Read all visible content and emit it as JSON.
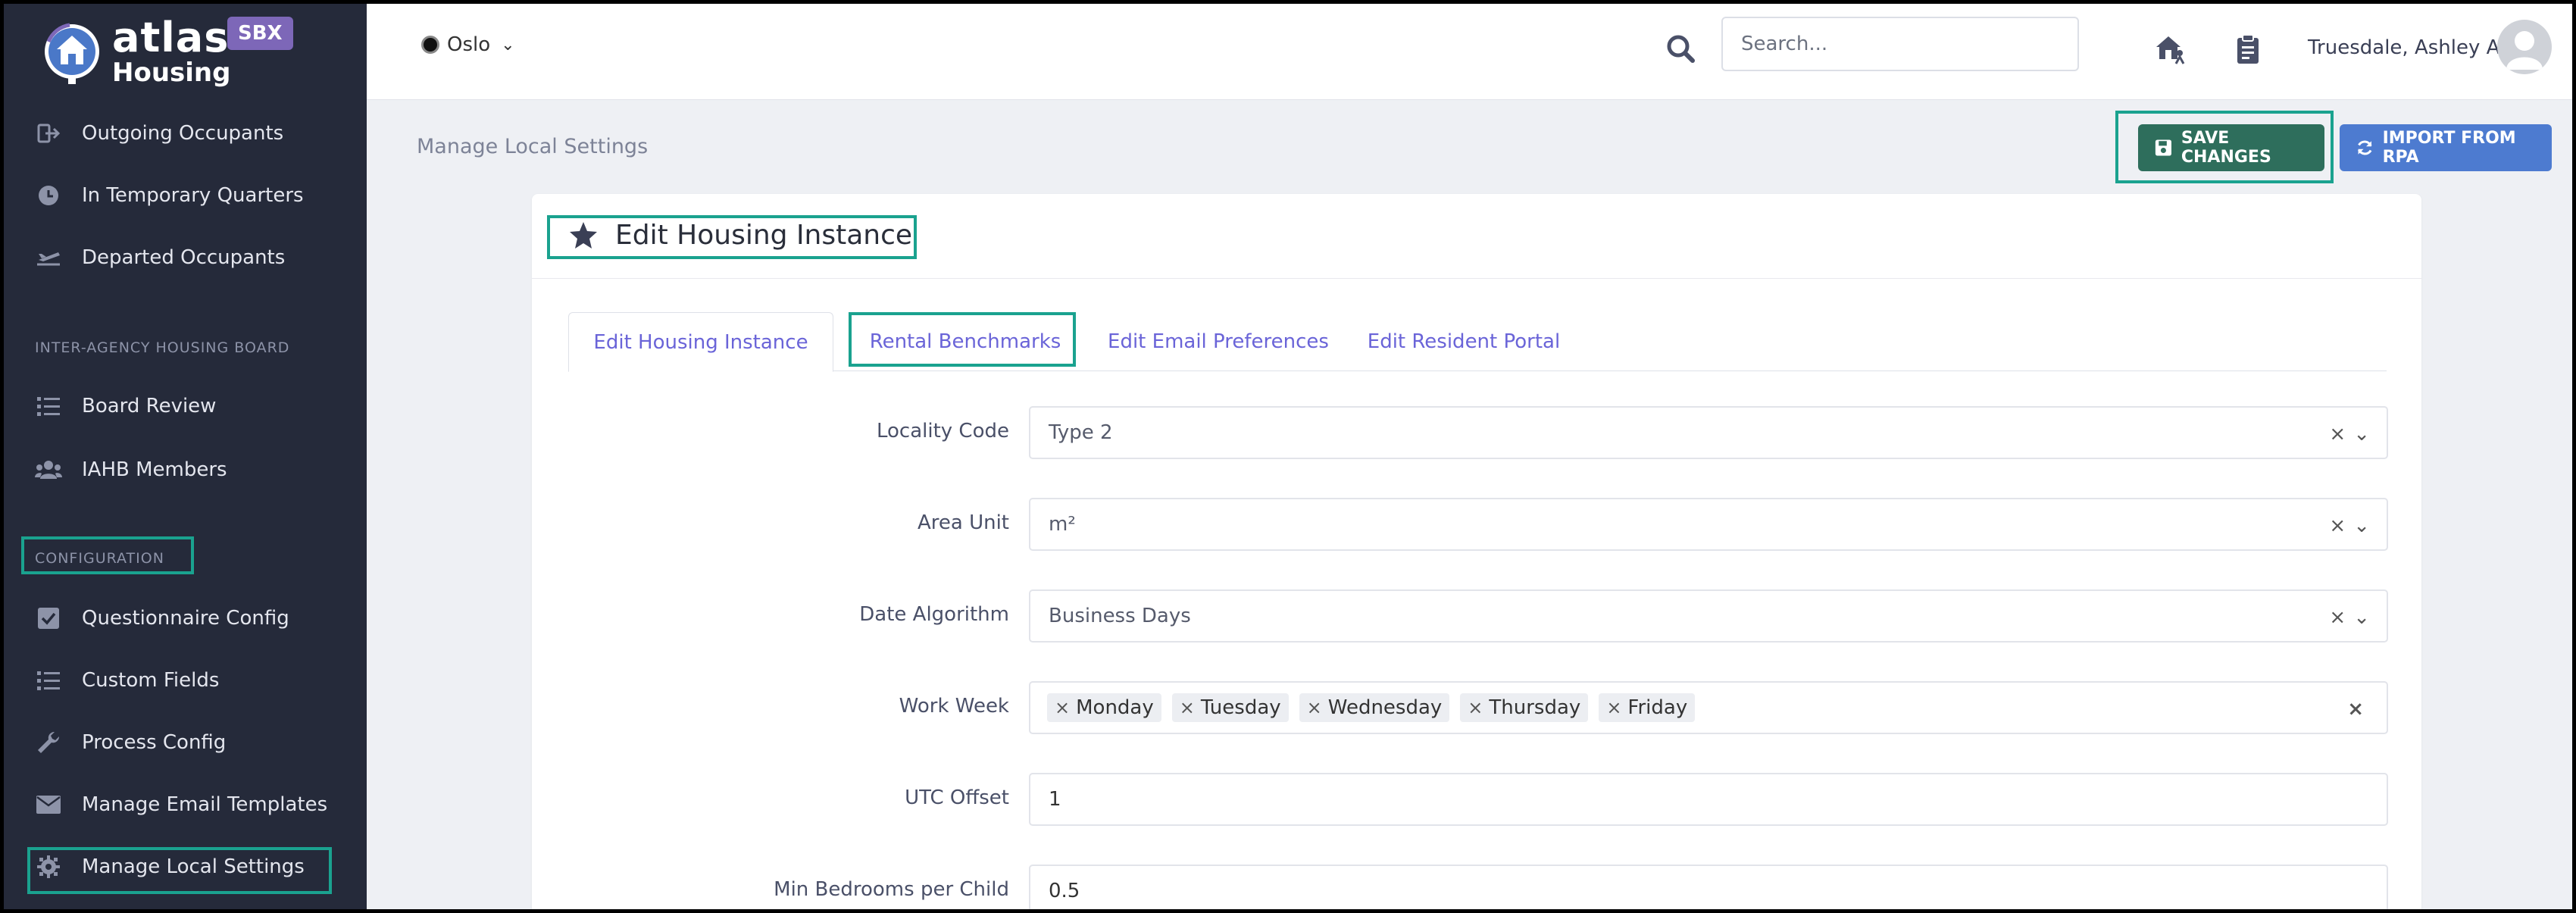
{
  "brand": {
    "line1": "atlas",
    "line2": "Housing",
    "badge": "SBX"
  },
  "sidebar": {
    "items": [
      {
        "label": "Outgoing Occupants",
        "icon": "sign-out-icon"
      },
      {
        "label": "In Temporary Quarters",
        "icon": "clock-icon"
      },
      {
        "label": "Departed Occupants",
        "icon": "plane-icon"
      }
    ],
    "section_board": "INTER-AGENCY HOUSING BOARD",
    "board_items": [
      {
        "label": "Board Review",
        "icon": "list-icon"
      },
      {
        "label": "IAHB Members",
        "icon": "users-icon"
      }
    ],
    "section_config": "CONFIGURATION",
    "config_items": [
      {
        "label": "Questionnaire Config",
        "icon": "checkbox-icon"
      },
      {
        "label": "Custom Fields",
        "icon": "list-icon"
      },
      {
        "label": "Process Config",
        "icon": "wrench-icon"
      },
      {
        "label": "Manage Email Templates",
        "icon": "envelope-icon"
      },
      {
        "label": "Manage Local Settings",
        "icon": "gear-icon"
      }
    ]
  },
  "topbar": {
    "location": "Oslo",
    "search_placeholder": "Search...",
    "user_name": "Truesdale, Ashley A"
  },
  "page": {
    "breadcrumb": "Manage Local Settings",
    "save_label": "SAVE CHANGES",
    "import_label": "IMPORT FROM RPA",
    "card_title": "Edit Housing Instance"
  },
  "tabs": [
    {
      "label": "Edit Housing Instance",
      "active": true
    },
    {
      "label": "Rental Benchmarks",
      "active": false
    },
    {
      "label": "Edit Email Preferences",
      "active": false
    },
    {
      "label": "Edit Resident Portal",
      "active": false
    }
  ],
  "form": {
    "locality_code": {
      "label": "Locality Code",
      "value": "Type 2"
    },
    "area_unit": {
      "label": "Area Unit",
      "value": "m²"
    },
    "date_algorithm": {
      "label": "Date Algorithm",
      "value": "Business Days"
    },
    "work_week": {
      "label": "Work Week",
      "values": [
        "Monday",
        "Tuesday",
        "Wednesday",
        "Thursday",
        "Friday"
      ]
    },
    "utc_offset": {
      "label": "UTC Offset",
      "value": "1"
    },
    "min_bedrooms": {
      "label": "Min Bedrooms per Child",
      "value": "0.5"
    }
  },
  "colors": {
    "sidebar_bg": "#252a3a",
    "highlight": "#1aa28f",
    "save_button": "#2e6e5c",
    "import_button": "#4d7bd0",
    "tab_link": "#6a64d8",
    "badge": "#7d67b8"
  }
}
